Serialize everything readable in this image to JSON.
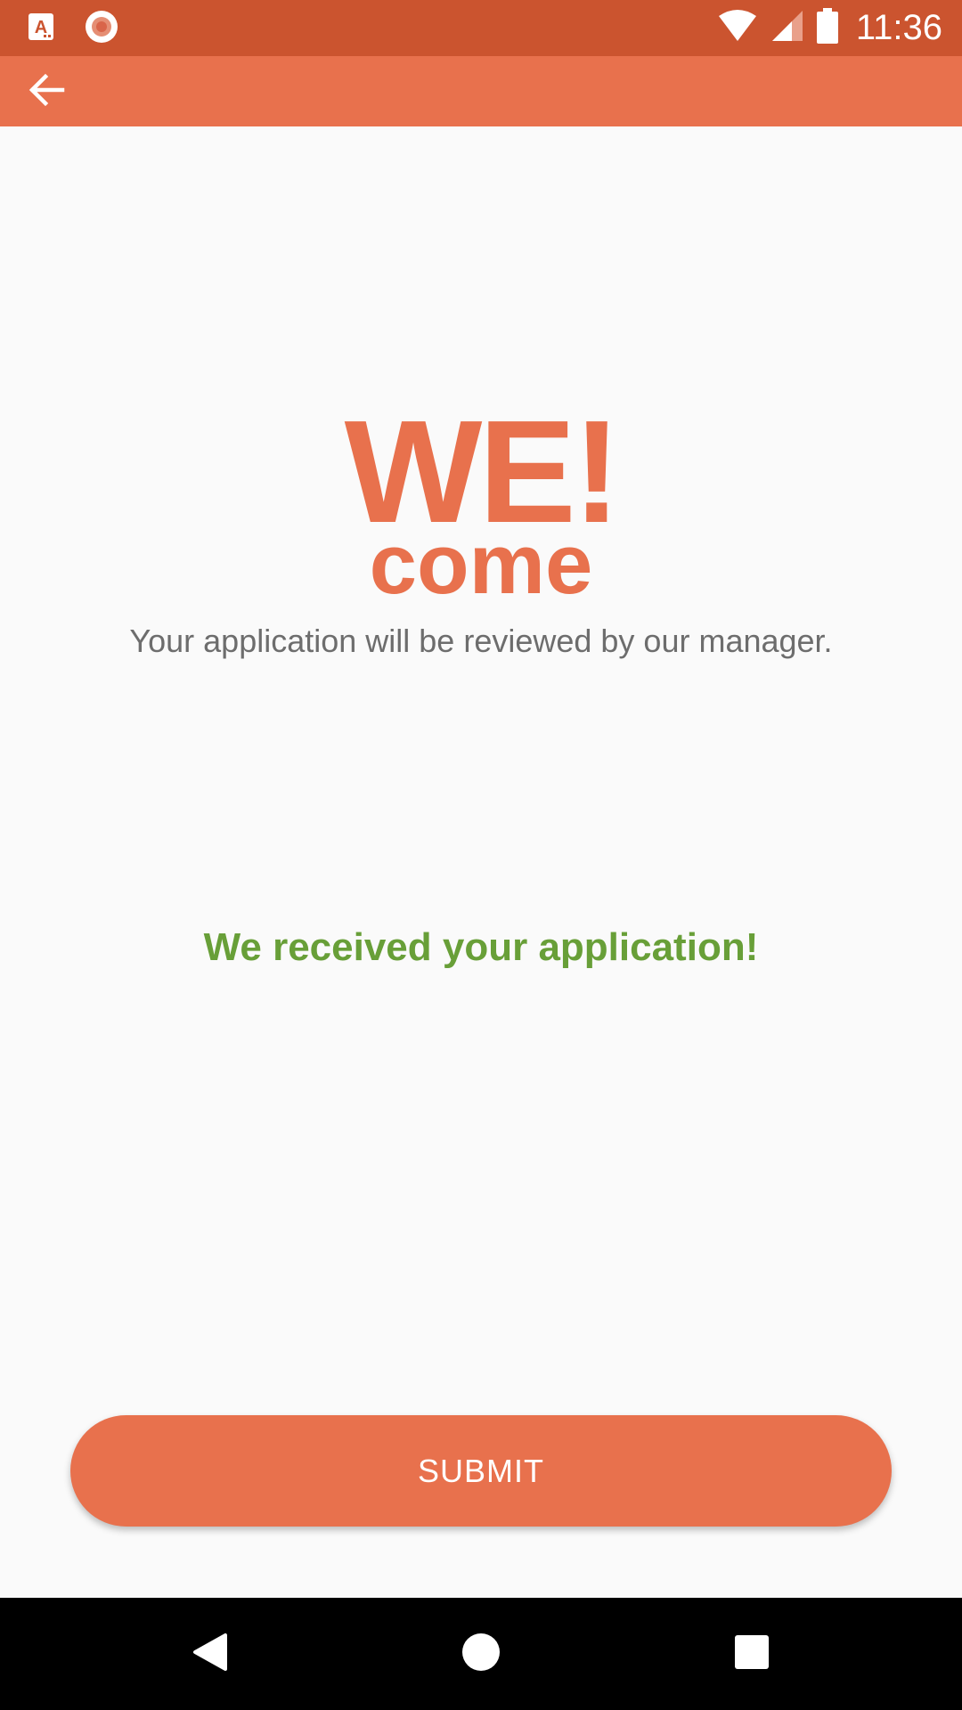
{
  "status_bar": {
    "time": "11:36",
    "background": "#cb542f",
    "left_icons": [
      "app-a-icon",
      "record-icon"
    ],
    "right_icons": [
      "wifi-icon",
      "cell-signal-icon",
      "battery-icon"
    ]
  },
  "app_bar": {
    "background": "#e8714d",
    "back_icon": "arrow-left-icon"
  },
  "main": {
    "logo_line1": "WE!",
    "logo_line2": "come",
    "subtitle": "Your application will be reviewed by our manager.",
    "confirmation": "We received your application!",
    "accent_color": "#e8714d",
    "confirmation_color": "#689f38"
  },
  "footer": {
    "submit_label": "SUBMIT"
  },
  "nav_bar": {
    "buttons": [
      "back-triangle-icon",
      "home-circle-icon",
      "recents-square-icon"
    ]
  }
}
